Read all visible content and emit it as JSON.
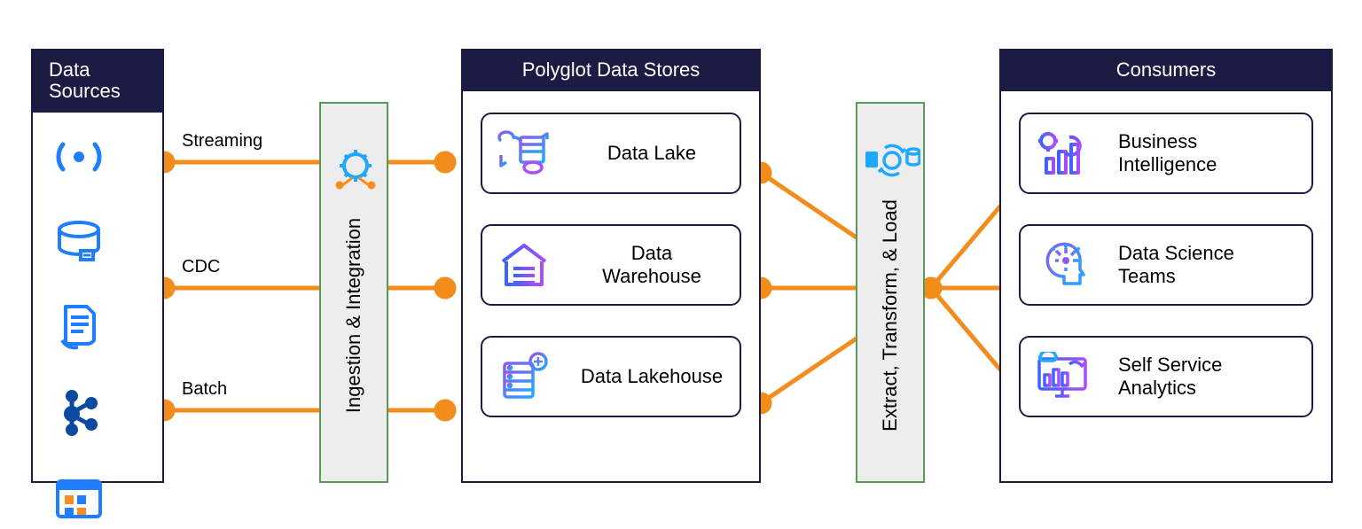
{
  "colors": {
    "panel_border": "#1b1b44",
    "panel_header_bg": "#1b1b44",
    "pillar_bg": "#ededed",
    "pillar_border": "#5a9a55",
    "connector": "#f28c1a"
  },
  "sources": {
    "title": "Data Sources",
    "icons": [
      "signal-icon",
      "database-icon",
      "log-file-icon",
      "kafka-icon",
      "calendar-apps-icon"
    ]
  },
  "ingestion_pillar": {
    "label": "Ingestion & Integration"
  },
  "flows": [
    {
      "label": "Streaming"
    },
    {
      "label": "CDC"
    },
    {
      "label": "Batch"
    }
  ],
  "stores": {
    "title": "Polyglot Data Stores",
    "items": [
      {
        "label": "Data Lake",
        "icon": "data-lake-icon"
      },
      {
        "label": "Data Warehouse",
        "icon": "data-warehouse-icon"
      },
      {
        "label": "Data Lakehouse",
        "icon": "data-lakehouse-icon"
      }
    ]
  },
  "etl_pillar": {
    "label": "Extract, Transform, & Load"
  },
  "consumers": {
    "title": "Consumers",
    "items": [
      {
        "label": "Business Intelligence",
        "icon": "bi-chart-icon"
      },
      {
        "label": "Data Science Teams",
        "icon": "ai-head-icon"
      },
      {
        "label": "Self Service Analytics",
        "icon": "dashboard-screen-icon"
      }
    ]
  }
}
